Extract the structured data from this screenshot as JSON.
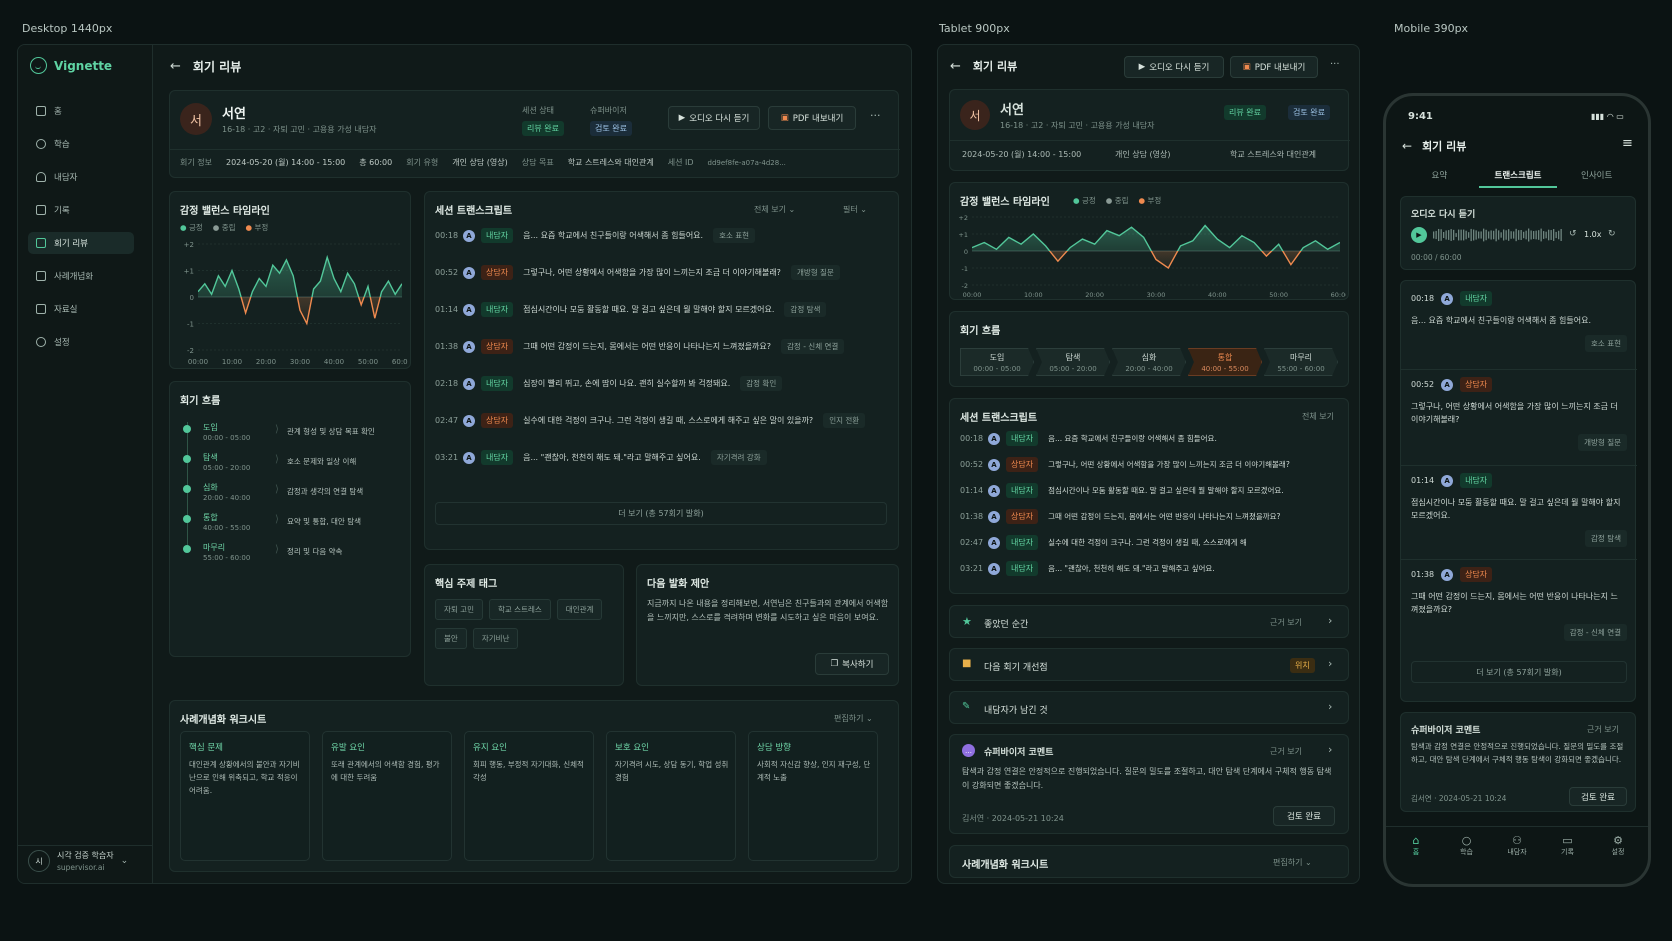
{
  "labels": {
    "desktop": "Desktop 1440px",
    "tablet": "Tablet 900px",
    "mobile": "Mobile 390px"
  },
  "app": {
    "name": "Vignette"
  },
  "sidebar": {
    "items": [
      {
        "label": "홈",
        "icon": "home-icon"
      },
      {
        "label": "학습",
        "icon": "chat-icon"
      },
      {
        "label": "내담자",
        "icon": "user-icon"
      },
      {
        "label": "기록",
        "icon": "record-icon"
      },
      {
        "label": "회기 리뷰",
        "icon": "review-icon",
        "active": true
      },
      {
        "label": "사례개념화",
        "icon": "case-icon"
      },
      {
        "label": "자료실",
        "icon": "library-icon"
      },
      {
        "label": "설정",
        "icon": "gear-icon"
      }
    ],
    "user": {
      "avatar": "시",
      "name": "시각 검증 학습자",
      "email": "supervisor.ai"
    }
  },
  "page": {
    "title": "회기 리뷰"
  },
  "client": {
    "avatar": "서",
    "name": "서연",
    "meta": "16-18 · 고2 · 자퇴 고민 · 고용용 가성 내담자",
    "status_label": "세션 상태",
    "status_value": "리뷰 완료",
    "supervisor_label": "슈퍼바이저",
    "supervisor_value": "검토 완료"
  },
  "actions": {
    "audio": "오디오 다시 듣기",
    "pdf": "PDF 내보내기",
    "more": "···"
  },
  "session_info": {
    "info_label": "회기 정보",
    "datetime": "2024-05-20 (월) 14:00 - 15:00",
    "duration": "총 60:00",
    "type_label": "회기 유형",
    "type_value": "개인 상담 (영상)",
    "goal_label": "상담 목표",
    "goal_value": "학교 스트레스와 대인관계",
    "id_label": "세션 ID",
    "id_value": "dd9ef8fe-a07a-4d28..."
  },
  "emotion": {
    "title": "감정 밸런스 타임라인",
    "legend": [
      "긍정",
      "중립",
      "부정"
    ],
    "y_ticks": [
      "+2",
      "+1",
      "0",
      "-1",
      "-2"
    ],
    "x_ticks": [
      "00:00",
      "10:00",
      "20:00",
      "30:00",
      "40:00",
      "50:00",
      "60:00"
    ]
  },
  "chart_data": {
    "type": "area",
    "x": [
      0,
      2,
      4,
      6,
      8,
      10,
      12,
      14,
      16,
      18,
      20,
      22,
      24,
      26,
      28,
      30,
      32,
      34,
      36,
      38,
      40,
      42,
      44,
      46,
      48,
      50,
      52,
      54,
      56,
      58,
      60
    ],
    "values": [
      0.2,
      0.5,
      0.1,
      0.8,
      0.4,
      1.0,
      0.3,
      -0.6,
      0.2,
      0.7,
      0.4,
      1.2,
      0.9,
      1.4,
      0.8,
      -0.5,
      -1.0,
      0.3,
      0.6,
      1.5,
      0.7,
      0.2,
      0.9,
      0.5,
      -0.3,
      0.4,
      -0.8,
      0.2,
      0.6,
      0.1,
      0.5
    ],
    "ylim": [
      -2,
      2
    ],
    "xlim": [
      0,
      60
    ]
  },
  "flow": {
    "title": "회기 흐름",
    "steps": [
      {
        "name": "도입",
        "time": "00:00 - 05:00",
        "desc": "관계 형성 및 상담 목표 확인"
      },
      {
        "name": "탐색",
        "time": "05:00 - 20:00",
        "desc": "호소 문제와 일상 이해"
      },
      {
        "name": "심화",
        "time": "20:00 - 40:00",
        "desc": "감정과 생각의 연결 탐색"
      },
      {
        "name": "통합",
        "time": "40:00 - 55:00",
        "desc": "요약 및 통합, 대안 탐색"
      },
      {
        "name": "마무리",
        "time": "55:00 - 60:00",
        "desc": "정리 및 다음 약속"
      }
    ]
  },
  "transcript": {
    "title": "세션 트랜스크립트",
    "view_all": "전체 보기",
    "filter": "필터",
    "more": "더 보기 (총 57회기 발화)",
    "rows": [
      {
        "time": "00:18",
        "role": "내담자",
        "text": "음... 요즘 학교에서 친구들이랑 어색해서 좀 힘들어요.",
        "tag": "호소 표현"
      },
      {
        "time": "00:52",
        "role": "상담자",
        "text": "그렇구나, 어떤 상황에서 어색함을 가장 많이 느끼는지 조금 더 이야기해볼래?",
        "tag": "개방형 질문"
      },
      {
        "time": "01:14",
        "role": "내담자",
        "text": "점심시간이나 모둠 활동할 때요. 말 걸고 싶은데 뭘 말해야 할지 모르겠어요.",
        "tag": "감정 탐색"
      },
      {
        "time": "01:38",
        "role": "상담자",
        "text": "그때 어떤 감정이 드는지, 몸에서는 어떤 반응이 나타나는지 느껴졌을까요?",
        "tag": "감정 - 신체 연결"
      },
      {
        "time": "02:18",
        "role": "내담자",
        "text": "심장이 빨리 뛰고, 손에 땀이 나요. 괜히 실수할까 봐 걱정돼요.",
        "tag": "감정 확인"
      },
      {
        "time": "02:47",
        "role": "상담자",
        "text": "실수에 대한 걱정이 크구나. 그런 걱정이 생길 때, 스스로에게 해주고 싶은 말이 있을까?",
        "tag": "인지 전환"
      },
      {
        "time": "03:21",
        "role": "내담자",
        "text": "음... \"괜찮아, 천천히 해도 돼.\"라고 말해주고 싶어요.",
        "tag": "자기격려 강화"
      }
    ]
  },
  "tags": {
    "title": "핵심 주제 태그",
    "items": [
      "자퇴 고민",
      "학교 스트레스",
      "대인관계",
      "불안",
      "자기비난"
    ]
  },
  "suggest": {
    "title": "다음 발화 제안",
    "text": "지금까지 나온 내용을 정리해보면, 서연님은 친구들과의 관계에서 어색함을 느끼지만, 스스로를 격려하며 변화를 시도하고 싶은 마음이 보여요.",
    "copy": "복사하기"
  },
  "worksheet": {
    "title": "사례개념화 워크시트",
    "edit": "편집하기",
    "cols": [
      {
        "title": "핵심 문제",
        "text": "대인관계 상황에서의 불안과 자기비난으로 인해 위축되고, 학교 적응이 어려움."
      },
      {
        "title": "유발 요인",
        "text": "또래 관계에서의 어색함 경험, 평가에 대한 두려움"
      },
      {
        "title": "유지 요인",
        "text": "회피 행동, 부정적 자기대화, 신체적 각성"
      },
      {
        "title": "보호 요인",
        "text": "자기격려 시도, 상담 동기, 학업 성취 경험"
      },
      {
        "title": "상담 방향",
        "text": "사회적 자신감 향상, 인지 재구성, 단계적 노출"
      }
    ]
  },
  "tablet": {
    "status": "리뷰 완료",
    "supervisor": "검토 완료",
    "datetime": "2024-05-20 (월) 14:00 - 15:00",
    "type": "개인 상담 (영상)",
    "goal": "학교 스트레스와 대인관계",
    "transcript_view_all": "전체 보기",
    "good_moment": "좋았던 순간",
    "good_link": "근거 보기",
    "improve": "다음 회기 개선점",
    "improve_badge": "위치",
    "client_left": "내담자가 남긴 것",
    "sup_title": "슈퍼바이저 코멘트",
    "sup_link": "근거 보기",
    "sup_text": "탐색과 감정 연결은 안정적으로 진행되었습니다. 질문의 밀도를 조절하고, 대안 탐색 단계에서 구체적 행동 탐색이 강화되면 좋겠습니다.",
    "sup_meta": "김서연 · 2024-05-21 10:24",
    "sup_btn": "검토 완료",
    "worksheet": "사례개념화 워크시트",
    "edit": "편집하기",
    "t_rows": [
      {
        "time": "00:18",
        "role": "내담자",
        "text": "음... 요즘 학교에서 친구들이랑 어색해서 좀 힘들어요."
      },
      {
        "time": "00:52",
        "role": "상담자",
        "text": "그렇구나, 어떤 상황에서 어색함을 가장 많이 느끼는지 조금 더 이야기해볼래?"
      },
      {
        "time": "01:14",
        "role": "내담자",
        "text": "점심시간이나 모둠 활동할 때요. 말 걸고 싶은데 뭘 말해야 할지 모르겠어요."
      },
      {
        "time": "01:38",
        "role": "상담자",
        "text": "그때 어떤 감정이 드는지, 몸에서는 어떤 반응이 나타나는지 느껴졌을까요?"
      },
      {
        "time": "02:47",
        "role": "내담자",
        "text": "실수에 대한 걱정이 크구나. 그런 걱정이 생길 때, 스스로에게 해"
      },
      {
        "time": "03:21",
        "role": "내담자",
        "text": "음... \"괜찮아, 천천히 해도 돼.\"라고 말해주고 싶어요."
      }
    ]
  },
  "mobile": {
    "time": "9:41",
    "tabs": [
      "요약",
      "트랜스크립트",
      "인사이트"
    ],
    "audio_title": "오디오 다시 듣기",
    "speed": "1.0x",
    "audio_time": "00:00 / 60:00",
    "items": [
      {
        "time": "00:18",
        "role": "내담자",
        "text": "음... 요즘 학교에서 친구들이랑 어색해서 좀 힘들어요.",
        "tag": "호소 표현"
      },
      {
        "time": "00:52",
        "role": "상담자",
        "text": "그렇구나, 어떤 상황에서 어색함을 가장 많이 느끼는지 조금 더 이야기해볼래?",
        "tag": "개방형 질문"
      },
      {
        "time": "01:14",
        "role": "내담자",
        "text": "점심시간이나 모둠 활동할 때요. 말 걸고 싶은데 뭘 말해야 할지 모르겠어요.",
        "tag": "감정 탐색"
      },
      {
        "time": "01:38",
        "role": "상담자",
        "text": "그때 어떤 감정이 드는지, 몸에서는 어떤 반응이 나타나는지 느껴졌을까요?",
        "tag": "감정 - 신체 연결"
      }
    ],
    "more": "더 보기 (총 57회기 발화)",
    "sup_title": "슈퍼바이저 코멘트",
    "sup_link": "근거 보기",
    "sup_text": "탐색과 감정 연결은 안정적으로 진행되었습니다. 질문의 밀도를 조절하고, 대안 탐색 단계에서 구체적 행동 탐색이 강화되면 좋겠습니다.",
    "sup_meta": "김서연 · 2024-05-21 10:24",
    "sup_btn": "검토 완료",
    "nav": [
      "홈",
      "학습",
      "내담자",
      "기록",
      "설정"
    ]
  },
  "colors": {
    "accent": "#52c79a",
    "negative": "#ef8a4f",
    "bg": "#0b1313"
  }
}
